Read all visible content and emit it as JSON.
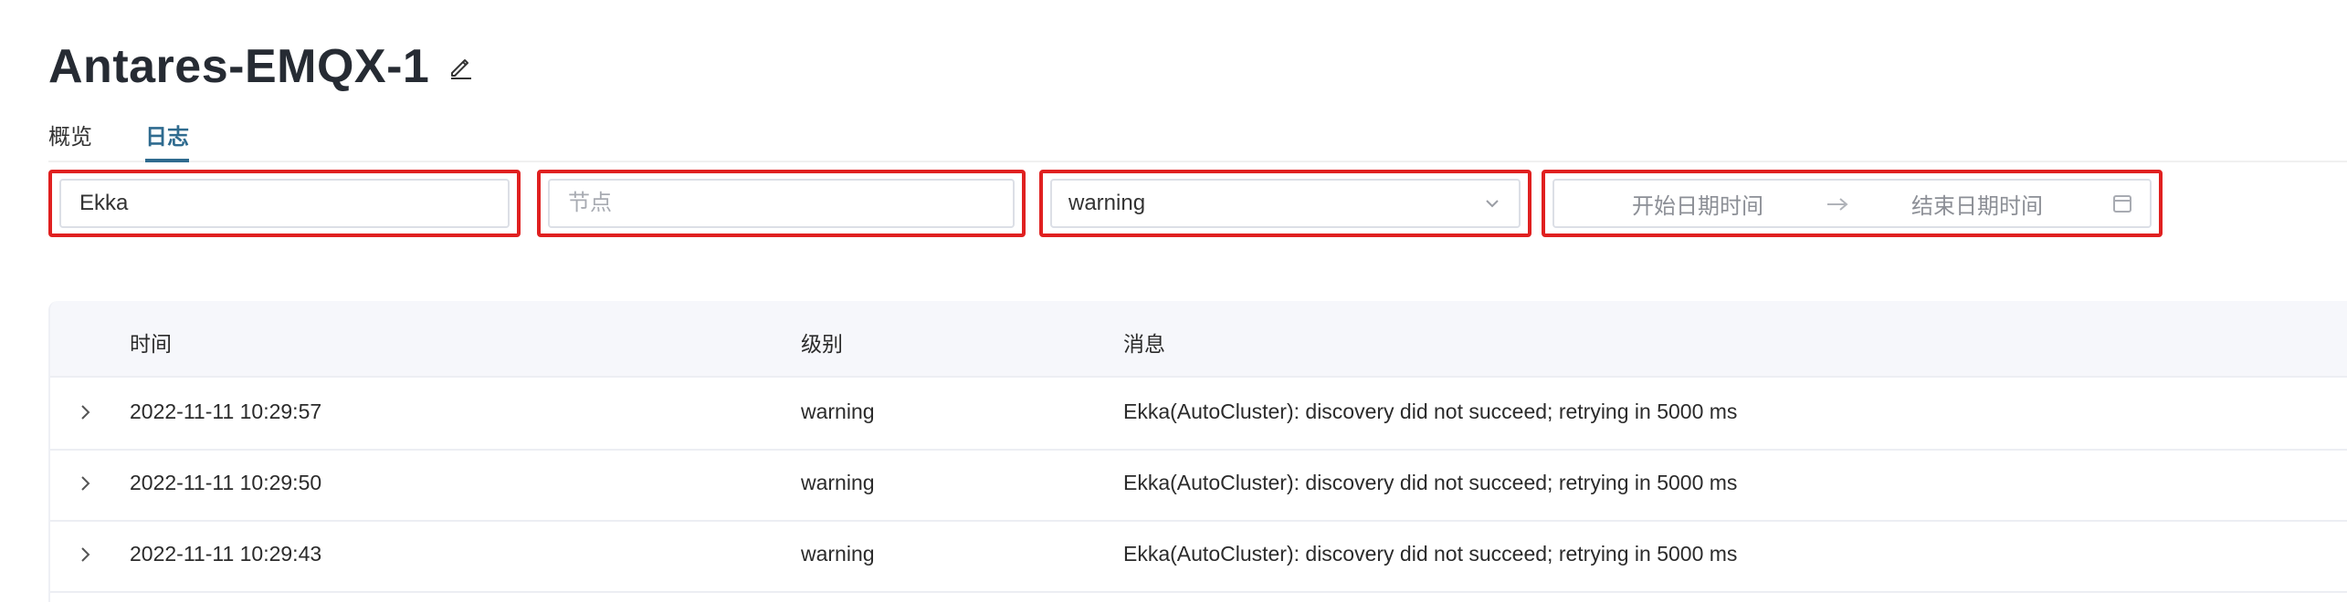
{
  "page": {
    "title": "Antares-EMQX-1"
  },
  "tabs": [
    {
      "label": "概览",
      "active": false
    },
    {
      "label": "日志",
      "active": true
    }
  ],
  "filters": {
    "keyword": {
      "value": "Ekka",
      "placeholder": ""
    },
    "node": {
      "value": "",
      "placeholder": "节点"
    },
    "level": {
      "selected": "warning"
    },
    "date_range": {
      "start_placeholder": "开始日期时间",
      "end_placeholder": "结束日期时间"
    }
  },
  "table": {
    "columns": [
      "时间",
      "级别",
      "消息"
    ],
    "rows": [
      {
        "time": "2022-11-11 10:29:57",
        "level": "warning",
        "message": "Ekka(AutoCluster): discovery did not succeed; retrying in 5000 ms"
      },
      {
        "time": "2022-11-11 10:29:50",
        "level": "warning",
        "message": "Ekka(AutoCluster): discovery did not succeed; retrying in 5000 ms"
      },
      {
        "time": "2022-11-11 10:29:43",
        "level": "warning",
        "message": "Ekka(AutoCluster): discovery did not succeed; retrying in 5000 ms"
      }
    ]
  },
  "colors": {
    "accent": "#2f6b8f",
    "highlight_border": "#e02020",
    "header_bg": "#f6f7fb"
  },
  "icons": {
    "edit": "pencil-icon",
    "select": "chevron-down-icon",
    "range": "arrow-right-icon",
    "calendar": "calendar-icon",
    "expand": "chevron-right-icon"
  }
}
